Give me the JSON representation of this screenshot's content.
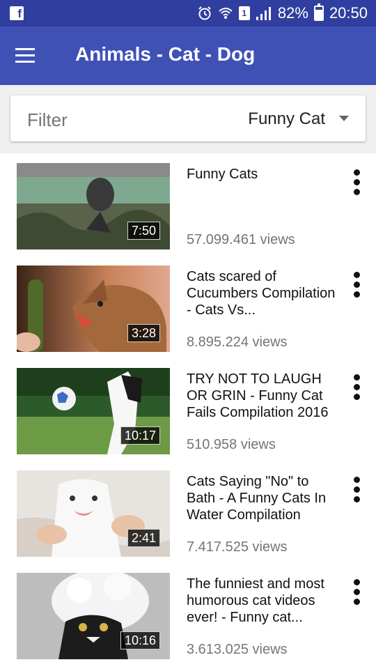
{
  "status_bar": {
    "battery": "82%",
    "time": "20:50",
    "sim_number": "1",
    "icons": [
      "facebook-icon",
      "alarm-icon",
      "wifi-icon",
      "sim-icon",
      "signal-icon",
      "battery-icon"
    ]
  },
  "app_bar": {
    "title": "Animals - Cat - Dog",
    "menu_icon": "hamburger-menu-icon",
    "color": "#3f51b5",
    "status_color": "#303f9f"
  },
  "filter": {
    "label": "Filter",
    "selected": "Funny Cat",
    "dropdown_icon": "dropdown-caret-icon"
  },
  "videos": [
    {
      "title": "Funny Cats",
      "views": "57.099.461 views",
      "duration": "7:50"
    },
    {
      "title": "Cats scared of Cucumbers Compilation - Cats Vs...",
      "views": "8.895.224 views",
      "duration": "3:28"
    },
    {
      "title": "TRY NOT TO LAUGH OR GRIN - Funny Cat Fails Compilation 2016",
      "views": "510.958 views",
      "duration": "10:17"
    },
    {
      "title": "Cats Saying \"No\" to Bath - A Funny Cats In Water Compilation",
      "views": "7.417.525 views",
      "duration": "2:41"
    },
    {
      "title": "The funniest and most humorous cat videos ever! - Funny cat...",
      "views": "3.613.025 views",
      "duration": "10:16"
    }
  ]
}
